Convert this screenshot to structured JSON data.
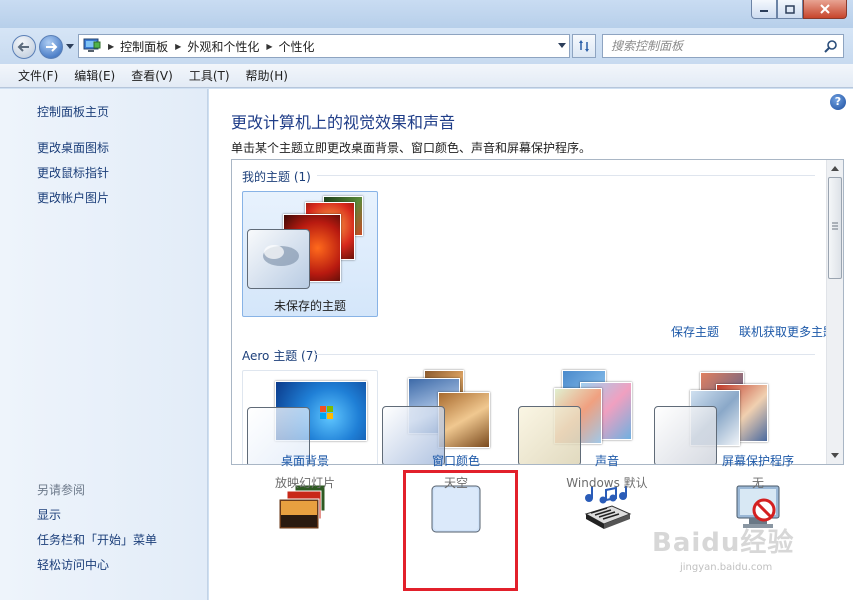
{
  "breadcrumb": [
    "控制面板",
    "外观和个性化",
    "个性化"
  ],
  "search": {
    "placeholder": "搜索控制面板"
  },
  "menu": [
    "文件(F)",
    "编辑(E)",
    "查看(V)",
    "工具(T)",
    "帮助(H)"
  ],
  "sidebar": {
    "home": "控制面板主页",
    "links": [
      "更改桌面图标",
      "更改鼠标指针",
      "更改帐户图片"
    ],
    "see_also_heading": "另请参阅",
    "see_also": [
      "显示",
      "任务栏和「开始」菜单",
      "轻松访问中心"
    ]
  },
  "main": {
    "title": "更改计算机上的视觉效果和声音",
    "description": "单击某个主题立即更改桌面背景、窗口颜色、声音和屏幕保护程序。",
    "my_themes_label": "我的主题 (1)",
    "unsaved_theme": "未保存的主题",
    "save_theme": "保存主题",
    "get_more_themes": "联机获取更多主题",
    "aero_themes_label": "Aero 主题 (7)"
  },
  "bottom": [
    {
      "label": "桌面背景",
      "sub": "放映幻灯片"
    },
    {
      "label": "窗口颜色",
      "sub": "天空"
    },
    {
      "label": "声音",
      "sub": "Windows 默认"
    },
    {
      "label": "屏幕保护程序",
      "sub": "无"
    }
  ],
  "watermark": {
    "brand": "Baidu经验",
    "url": "jingyan.baidu.com"
  },
  "colors": {
    "accent": "#1f3d88",
    "link": "#1c58a8",
    "highlight": "#e2202b"
  }
}
